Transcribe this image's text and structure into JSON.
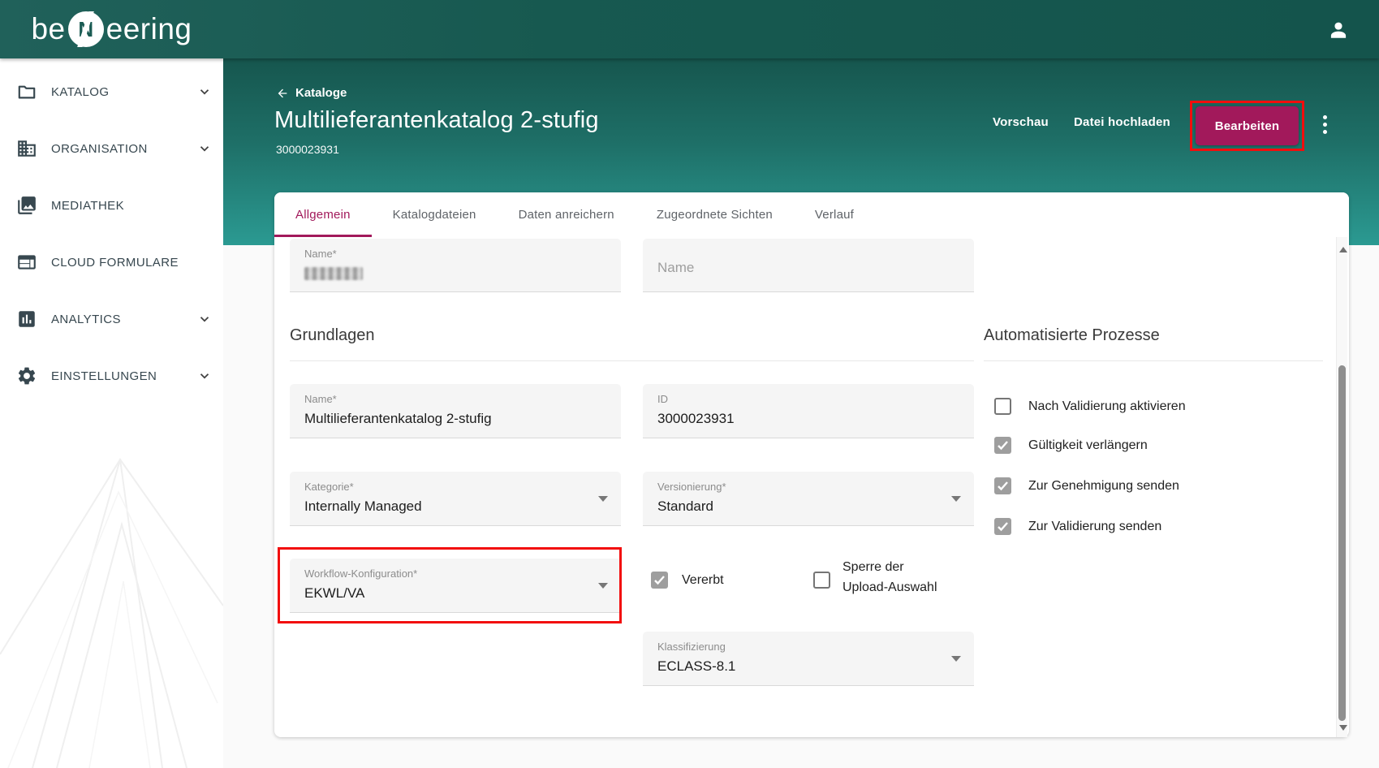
{
  "colors": {
    "accent_magenta": "#a2195b",
    "annotation_red": "#f20d0d",
    "teal_dark": "#16564e",
    "teal_light": "#2b9a92",
    "checkbox_checked_gray": "#9e9e9e"
  },
  "topbar": {
    "logo_prefix": "be",
    "logo_mark": "N",
    "logo_suffix": "eering"
  },
  "sidebar": {
    "items": [
      {
        "label": "KATALOG",
        "icon": "folder-icon",
        "expandable": true
      },
      {
        "label": "ORGANISATION",
        "icon": "building-icon",
        "expandable": true
      },
      {
        "label": "MEDIATHEK",
        "icon": "media-library-icon",
        "expandable": false
      },
      {
        "label": "CLOUD FORMULARE",
        "icon": "forms-icon",
        "expandable": false
      },
      {
        "label": "ANALYTICS",
        "icon": "analytics-icon",
        "expandable": true
      },
      {
        "label": "EINSTELLUNGEN",
        "icon": "settings-icon",
        "expandable": true
      }
    ]
  },
  "header": {
    "back_label": "Kataloge",
    "title": "Multilieferantenkatalog 2-stufig",
    "catalog_id": "3000023931",
    "preview_label": "Vorschau",
    "upload_label": "Datei hochladen",
    "edit_label": "Bearbeiten",
    "highlighted_action": "Bearbeiten"
  },
  "tabs": [
    {
      "label": "Allgemein",
      "active": true
    },
    {
      "label": "Katalogdateien",
      "active": false
    },
    {
      "label": "Daten anreichern",
      "active": false
    },
    {
      "label": "Zugeordnete Sichten",
      "active": false
    },
    {
      "label": "Verlauf",
      "active": false
    }
  ],
  "form": {
    "partial_row": {
      "left_label": "Name*",
      "left_value_redacted": true,
      "right_placeholder": "Name"
    },
    "grundlagen": {
      "heading": "Grundlagen",
      "name_label": "Name*",
      "name_value": "Multilieferantenkatalog 2-stufig",
      "id_label": "ID",
      "id_value": "3000023931",
      "kategorie_label": "Kategorie*",
      "kategorie_value": "Internally Managed",
      "versionierung_label": "Versionierung*",
      "versionierung_value": "Standard",
      "workflow_label": "Workflow-Konfiguration*",
      "workflow_value": "EKWL/VA",
      "workflow_highlighted": true,
      "klassifizierung_label": "Klassifizierung",
      "klassifizierung_value": "ECLASS-8.1",
      "vererbt_label": "Vererbt",
      "vererbt_checked": true,
      "sperre_label": "Sperre der Upload-Auswahl",
      "sperre_checked": false
    },
    "automatisierte": {
      "heading": "Automatisierte Prozesse",
      "checkboxes": [
        {
          "label": "Nach Validierung aktivieren",
          "checked": false
        },
        {
          "label": "Gültigkeit verlängern",
          "checked": true
        },
        {
          "label": "Zur Genehmigung senden",
          "checked": true
        },
        {
          "label": "Zur Validierung senden",
          "checked": true
        }
      ]
    }
  }
}
